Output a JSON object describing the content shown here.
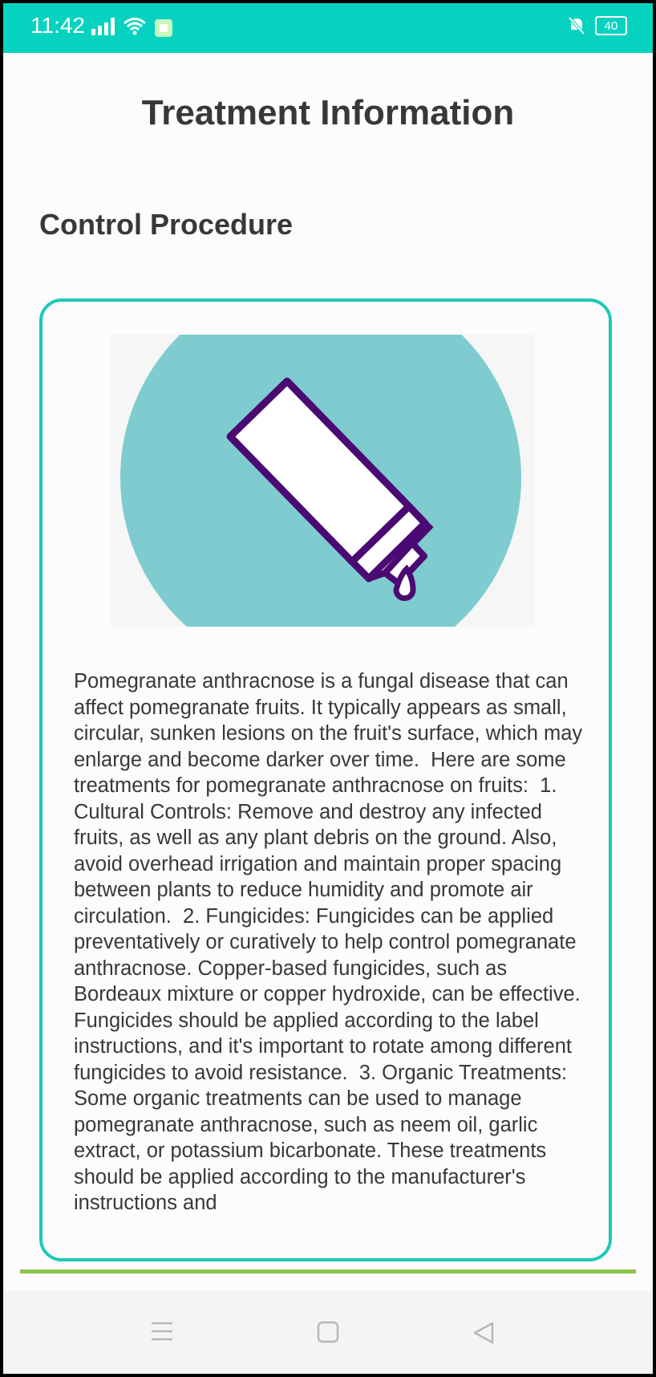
{
  "status_bar": {
    "time": "11:42",
    "battery": "40"
  },
  "page": {
    "title": "Treatment Information",
    "section_heading": "Control Procedure"
  },
  "treatment": {
    "image_icon": "ointment-tube-icon",
    "description": "Pomegranate anthracnose is a fungal disease that can affect pomegranate fruits. It typically appears as small, circular, sunken lesions on the fruit's surface, which may enlarge and become darker over time.  Here are some treatments for pomegranate anthracnose on fruits:  1. Cultural Controls: Remove and destroy any infected fruits, as well as any plant debris on the ground. Also, avoid overhead irrigation and maintain proper spacing between plants to reduce humidity and promote air circulation.  2. Fungicides: Fungicides can be applied preventatively or curatively to help control pomegranate anthracnose. Copper-based fungicides, such as Bordeaux mixture or copper hydroxide, can be effective. Fungicides should be applied according to the label instructions, and it's important to rotate among different fungicides to avoid resistance.  3. Organic Treatments: Some organic treatments can be used to manage pomegranate anthracnose, such as neem oil, garlic extract, or potassium bicarbonate. These treatments should be applied according to the manufacturer's instructions and"
  },
  "colors": {
    "status_bar": "#06d3bf",
    "card_border": "#1dc9b7",
    "image_circle": "#7ecccf",
    "icon_stroke": "#4b0a73",
    "divider": "#8cc44b"
  },
  "nav_bar": {
    "menu_icon": "menu-icon",
    "home_icon": "home-square-icon",
    "back_icon": "back-triangle-icon"
  }
}
